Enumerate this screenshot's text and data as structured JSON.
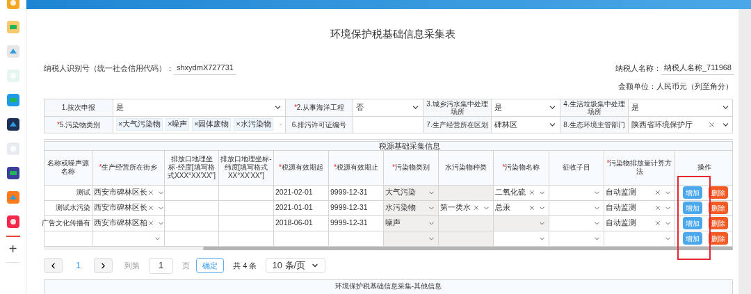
{
  "sidebar": {
    "add": "+"
  },
  "title": "环境保护税基础信息采集表",
  "taxpayer_id": {
    "label": "纳税人识别号（统一社会信用代码）：",
    "value": "shxydmX727731"
  },
  "taxpayer_name": {
    "label": "纳税人名称：",
    "value": "纳税人名称_711968"
  },
  "currency_note": "金额单位：人民币元（列至角分）",
  "basic_info": [
    [
      {
        "label": "1.按次申报",
        "kind": "select",
        "value": "是"
      },
      {
        "mark": "*",
        "label": "2.从事海洋工程",
        "kind": "select",
        "value": "否"
      },
      {
        "label": "3.城乡污水集中处理场所",
        "kind": "select",
        "value": "是"
      },
      {
        "label": "4.生活垃圾集中处理场所",
        "kind": "select",
        "value": "是"
      }
    ],
    [
      {
        "mark": "*",
        "label": "5.污染物类别",
        "kind": "tags",
        "tags": [
          "×大气污染物",
          "×噪声",
          "×固体废物",
          "×水污染物"
        ]
      },
      {
        "label": "6.排污许可证编号",
        "kind": "text"
      },
      {
        "label": "7.生产经营所在区划",
        "kind": "select",
        "value": "碑林区"
      },
      {
        "label": "8.生态环境主管部门",
        "kind": "select",
        "value": "陕西省环境保护厅",
        "clearable": true
      }
    ]
  ],
  "source_table": {
    "caption": "税源基础采集信息",
    "columns": [
      {
        "label": "名称或噪声源名称"
      },
      {
        "mark": "*",
        "label": "生产经营所在街乡"
      },
      {
        "label": "排放口地理坐标-经度[填写格式XXX°XX′XX″]"
      },
      {
        "label": "排放口地理坐标-纬度[填写格式XX°XX′XX″]"
      },
      {
        "mark": "*",
        "label": "税源有效期起"
      },
      {
        "mark": "*",
        "label": "税源有效期止"
      },
      {
        "mark": "*",
        "label": "污染物类别"
      },
      {
        "label": "水污染物种类"
      },
      {
        "mark": "*",
        "label": "污染物名称"
      },
      {
        "label": "征收子目"
      },
      {
        "mark": "*",
        "label": "污染物排放量计算方法"
      },
      {
        "label": "操作"
      }
    ],
    "rows": [
      {
        "cells": [
          {
            "kind": "text",
            "value": "测试"
          },
          {
            "kind": "select",
            "value": "西安市碑林区长",
            "clearable": true
          },
          {
            "kind": "text"
          },
          {
            "kind": "text"
          },
          {
            "kind": "text",
            "value": "2021-02-01"
          },
          {
            "kind": "text",
            "value": "9999-12-31"
          },
          {
            "kind": "select",
            "value": "大气污染",
            "disabled": true
          },
          {
            "kind": "blank",
            "disabled": true
          },
          {
            "kind": "select",
            "value": "二氧化硫",
            "clearable": true
          },
          {
            "kind": "select"
          },
          {
            "kind": "select",
            "value": "自动监测",
            "clearable": true
          }
        ],
        "add": "增加",
        "delete": "删除"
      },
      {
        "cells": [
          {
            "kind": "text",
            "value": "测试水污染"
          },
          {
            "kind": "select",
            "value": "西安市碑林区长",
            "clearable": true
          },
          {
            "kind": "text"
          },
          {
            "kind": "text"
          },
          {
            "kind": "text",
            "value": "2021-01-01"
          },
          {
            "kind": "text",
            "value": "9999-12-31"
          },
          {
            "kind": "select",
            "value": "水污染物",
            "disabled": true
          },
          {
            "kind": "select",
            "value": "第一类水",
            "clearable": true
          },
          {
            "kind": "select",
            "value": "总汞",
            "clearable": true
          },
          {
            "kind": "select"
          },
          {
            "kind": "select",
            "value": "自动监测",
            "clearable": true
          }
        ],
        "add": "增加",
        "delete": "删除"
      },
      {
        "cells": [
          {
            "kind": "text",
            "value": "广告文化传播有"
          },
          {
            "kind": "select",
            "value": "西安市碑林区柏",
            "clearable": true
          },
          {
            "kind": "text"
          },
          {
            "kind": "text"
          },
          {
            "kind": "text",
            "value": "2018-06-01"
          },
          {
            "kind": "text",
            "value": "9999-12-31"
          },
          {
            "kind": "select",
            "value": "噪声",
            "disabled": true
          },
          {
            "kind": "blank",
            "disabled": true
          },
          {
            "kind": "select",
            "disabled": true
          },
          {
            "kind": "select"
          },
          {
            "kind": "select",
            "value": "自动监测",
            "clearable": true
          }
        ],
        "add": "增加",
        "delete": "删除"
      },
      {
        "cells": [
          {
            "kind": "text"
          },
          {
            "kind": "select"
          },
          {
            "kind": "text"
          },
          {
            "kind": "text"
          },
          {
            "kind": "text"
          },
          {
            "kind": "text"
          },
          {
            "kind": "select",
            "disabled": true
          },
          {
            "kind": "blank",
            "disabled": true
          },
          {
            "kind": "select"
          },
          {
            "kind": "select"
          },
          {
            "kind": "select"
          }
        ],
        "add": "增加",
        "delete": "删除"
      }
    ]
  },
  "pagination": {
    "pages": [
      {
        "label": "1",
        "selected": true
      }
    ],
    "goto_label": "到第",
    "goto_value": "1",
    "page_unit": "页",
    "confirm": "确定",
    "total": "共 4 条",
    "page_size": "10 条/页"
  },
  "other_section": {
    "title": "环境保护税基础信息采集-其他信息"
  }
}
